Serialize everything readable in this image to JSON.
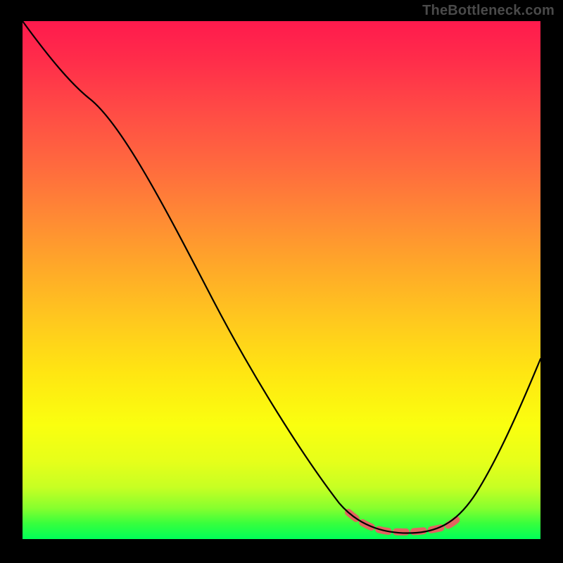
{
  "watermark": "TheBottleneck.com",
  "colors": {
    "background": "#000000",
    "gradient_stops": [
      {
        "pos": 0.0,
        "hex": "#ff1a4d"
      },
      {
        "pos": 0.18,
        "hex": "#ff4d45"
      },
      {
        "pos": 0.38,
        "hex": "#ff8a34"
      },
      {
        "pos": 0.58,
        "hex": "#ffc91e"
      },
      {
        "pos": 0.78,
        "hex": "#faff0f"
      },
      {
        "pos": 0.94,
        "hex": "#87ff2e"
      },
      {
        "pos": 1.0,
        "hex": "#00ff58"
      }
    ],
    "curve": "#000000",
    "highlight": "#e26360"
  },
  "chart_data": {
    "type": "line",
    "title": "",
    "xlabel": "",
    "ylabel": "",
    "xlim": [
      0,
      100
    ],
    "ylim": [
      0,
      100
    ],
    "series": [
      {
        "name": "bottleneck-curve",
        "x": [
          0,
          6,
          12,
          18,
          25,
          32,
          40,
          48,
          56,
          62,
          68,
          74,
          78,
          82,
          86,
          90,
          95,
          100
        ],
        "y": [
          100,
          92,
          86,
          80,
          68,
          55,
          40,
          26,
          14,
          7,
          3,
          1,
          1,
          2,
          6,
          14,
          24,
          35
        ]
      }
    ],
    "highlight_range_x": [
      63,
      84
    ],
    "notes": "No axis ticks or numeric labels are visible; x and y values are estimated on a 0–100 normalized scale from the curve geometry. The curve shows a steep near-linear descent from top-left to a valley around x≈74–78 (y≈1), then rises toward the right edge. A dashed salmon overlay marks the flat bottom between roughly x=63 and x=84."
  }
}
